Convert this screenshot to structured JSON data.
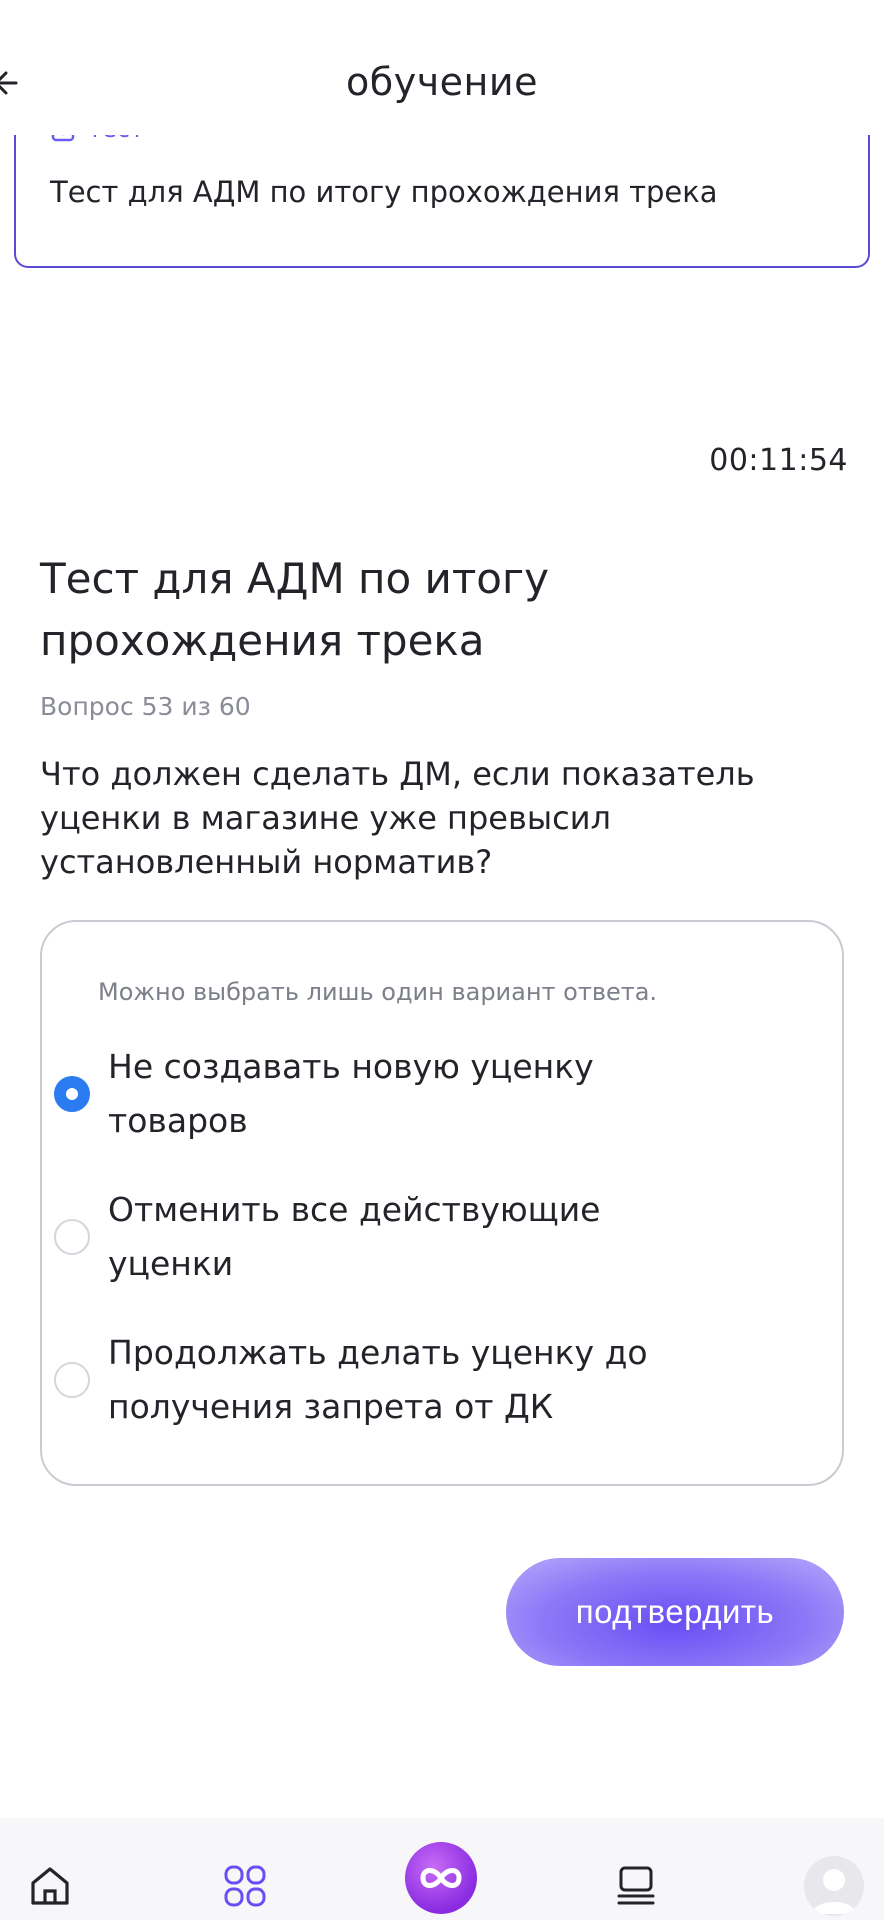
{
  "header": {
    "title": "обучение"
  },
  "lesson_card": {
    "tag_label": "тест",
    "title": "Тест для АДМ по итогу прохождения трека"
  },
  "timer": "00:11:54",
  "test": {
    "title": "Тест для АДМ по итогу прохождения трека",
    "counter": "Вопрос 53 из 60",
    "question": "Что должен сделать ДМ, если показатель уценки в магазине уже превысил установленный норматив?"
  },
  "options": {
    "hint": "Можно выбрать лишь один вариант ответа.",
    "items": [
      {
        "label": "Не создавать новую уценку товаров",
        "selected": true
      },
      {
        "label": "Отменить все действующие уценки",
        "selected": false
      },
      {
        "label": "Продолжать делать уценку до получения запрета от ДК",
        "selected": false
      }
    ]
  },
  "confirm_label": "подтвердить",
  "colors": {
    "accent": "#6a4df5",
    "radio_selected": "#2a7cf0",
    "card_border": "#5a4bd6"
  },
  "nav": {
    "icons": [
      "home-icon",
      "catalog-grid-icon",
      "infinity-logo-icon",
      "tasks-list-icon",
      "profile-avatar-icon"
    ]
  }
}
